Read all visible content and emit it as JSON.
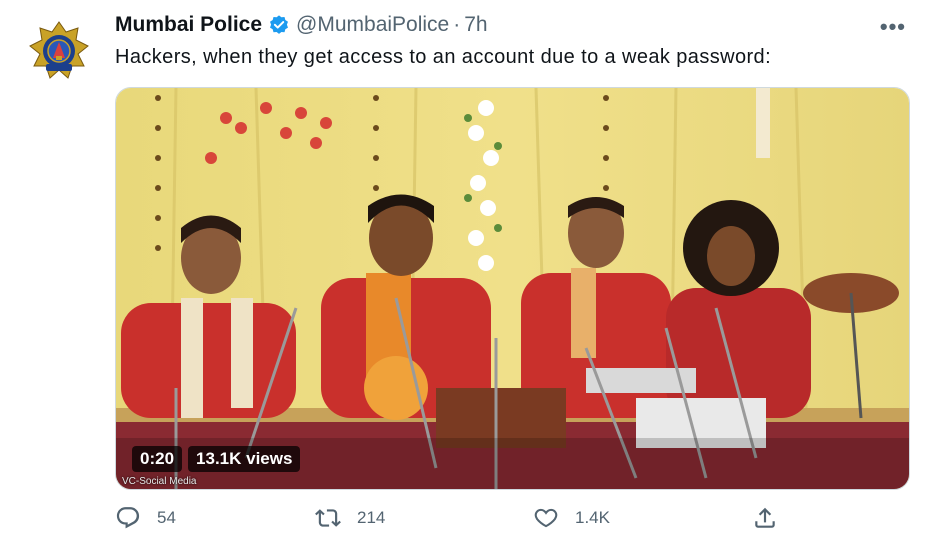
{
  "tweet": {
    "author_name": "Mumbai Police",
    "handle": "@MumbaiPolice",
    "separator": "·",
    "time": "7h",
    "more_label": "•••",
    "text": "Hackers, when they get access to an account due to a weak password:"
  },
  "media": {
    "duration": "0:20",
    "views": "13.1K views",
    "watermark": "VC-Social Media"
  },
  "actions": {
    "replies": "54",
    "retweets": "214",
    "likes": "1.4K"
  },
  "icons": {
    "verified": "verified-badge-icon",
    "reply": "reply-icon",
    "retweet": "retweet-icon",
    "like": "heart-icon",
    "share": "share-icon",
    "more": "more-icon"
  },
  "colors": {
    "accent": "#1d9bf0",
    "muted": "#536471"
  }
}
